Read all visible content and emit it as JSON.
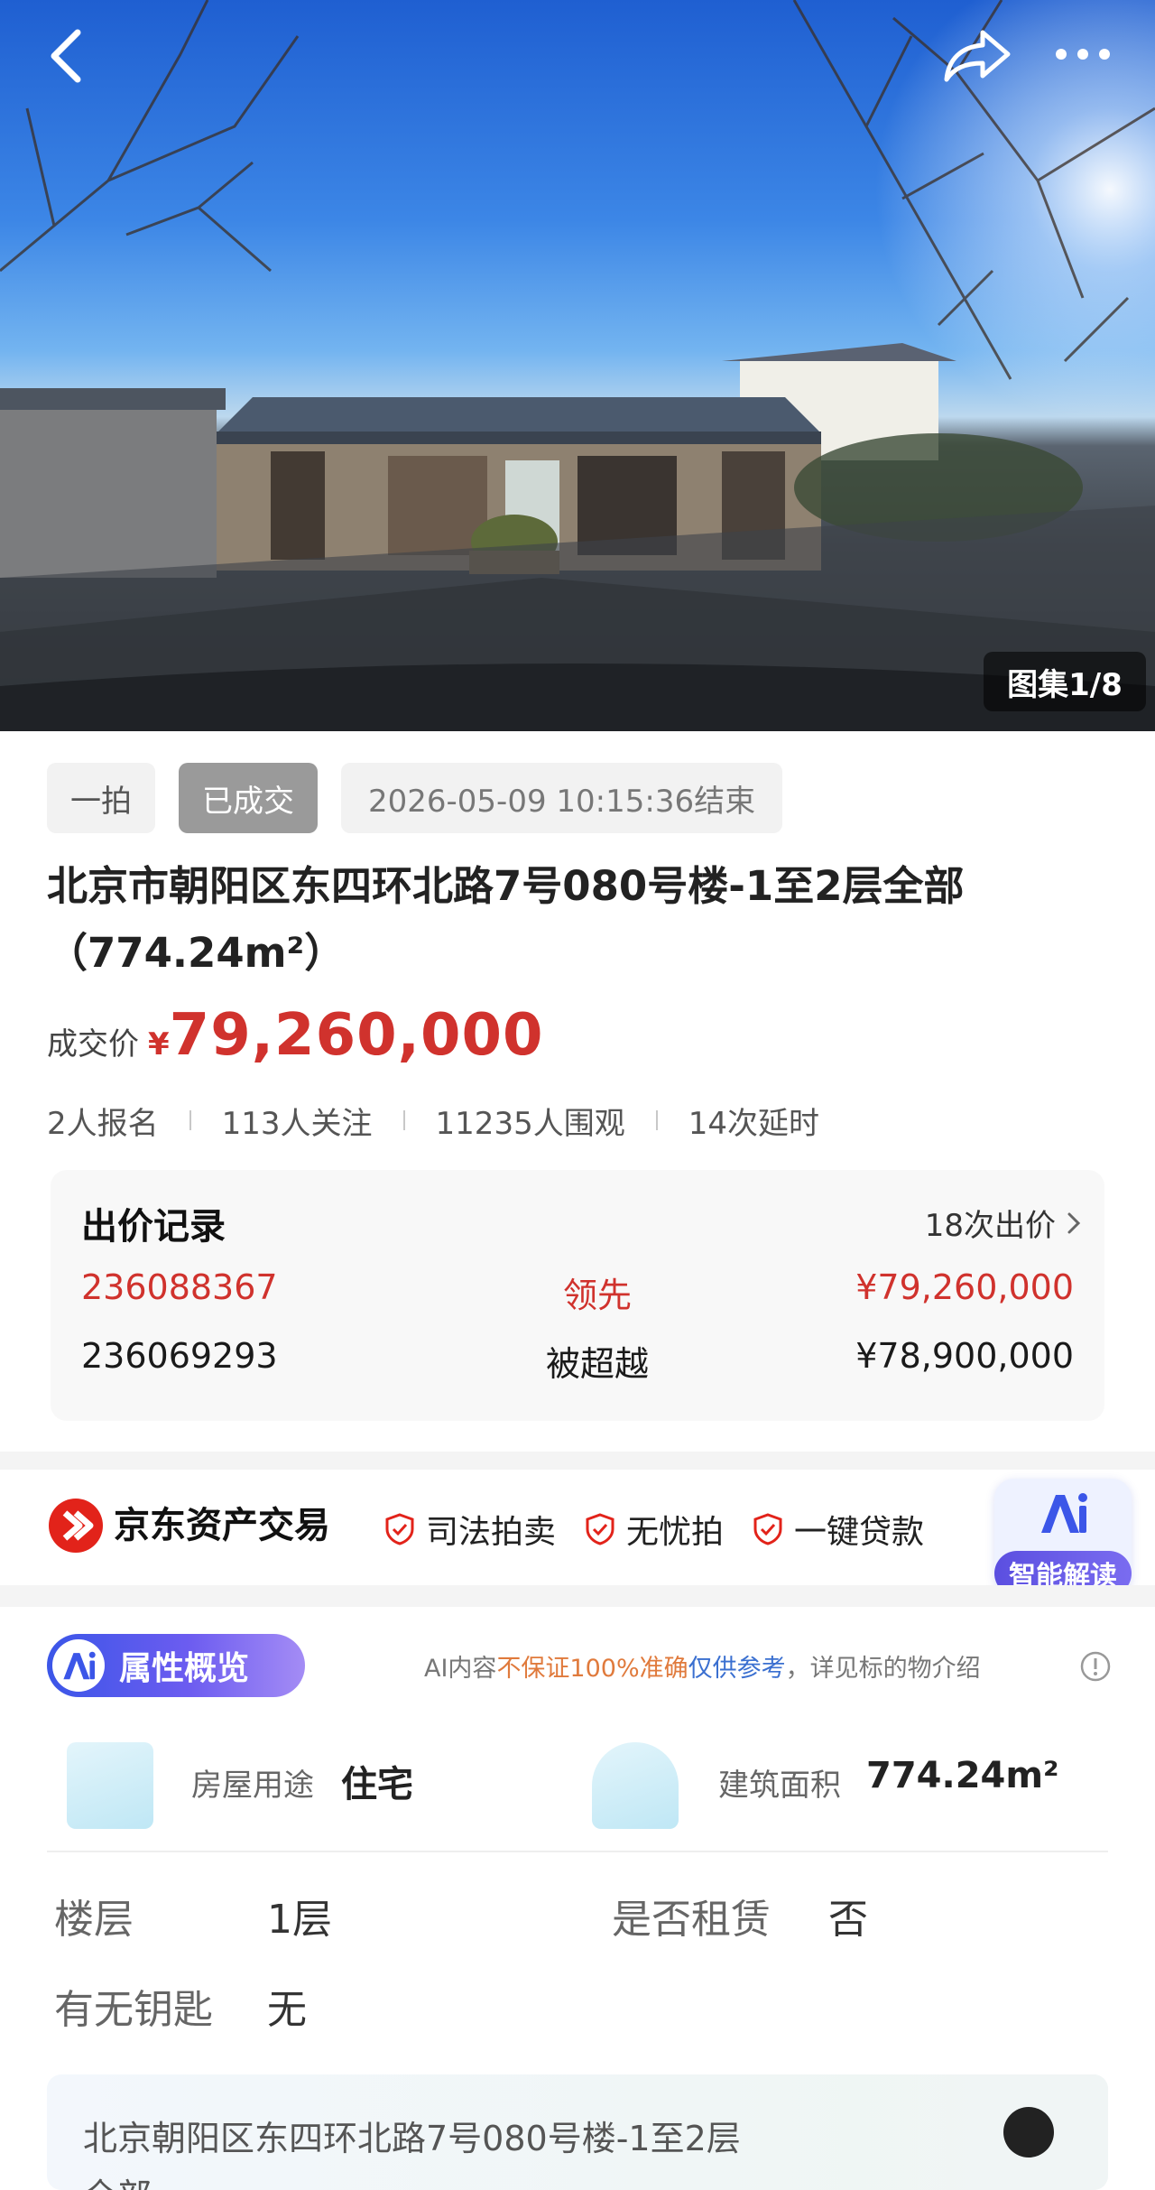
{
  "gallery": {
    "counter": "图集1/8"
  },
  "icons": {
    "back": "back-arrow-icon",
    "share": "share-icon",
    "more": "more-dots-icon"
  },
  "auction": {
    "type_tag": "一拍",
    "status_tag": "已成交",
    "end_time": "2026-05-09 10:15:36结束",
    "title": "北京市朝阳区东四环北路7号080号楼-1至2层全部（774.24m²）",
    "price_label": "成交价",
    "currency": "¥",
    "price": "79,260,000",
    "stats": [
      "2人报名",
      "113人关注",
      "11235人围观",
      "14次延时"
    ]
  },
  "bids": {
    "title": "出价记录",
    "count": "18次出价",
    "rows": [
      {
        "bidder": "236088367",
        "state": "领先",
        "amount": "¥79,260,000"
      },
      {
        "bidder": "236069293",
        "state": "被超越",
        "amount": "¥78,900,000"
      }
    ]
  },
  "platform": {
    "name": "京东资产交易",
    "badges": [
      "司法拍卖",
      "无忧拍",
      "一键贷款"
    ],
    "ai_read": "智能解读"
  },
  "attributes": {
    "pill": "属性概览",
    "disclaimer": {
      "prefix": "AI内容",
      "highlight": "不保证100%准确",
      "link": "仅供参考",
      "suffix": "，详见标的物介绍"
    },
    "usage_label": "房屋用途",
    "usage_value": "住宅",
    "area_label": "建筑面积",
    "area_value": "774.24m²",
    "floor_label": "楼层",
    "floor_value": "1层",
    "lease_label": "是否租赁",
    "lease_value": "否",
    "key_label": "有无钥匙",
    "key_value": "无",
    "address": "北京朝阳区东四环北路7号080号楼-1至2层",
    "address_cont": "全部"
  },
  "colors": {
    "accent_red": "#d0322d",
    "ai_purple": "#5b4fe0",
    "jd_red": "#e2231a"
  }
}
